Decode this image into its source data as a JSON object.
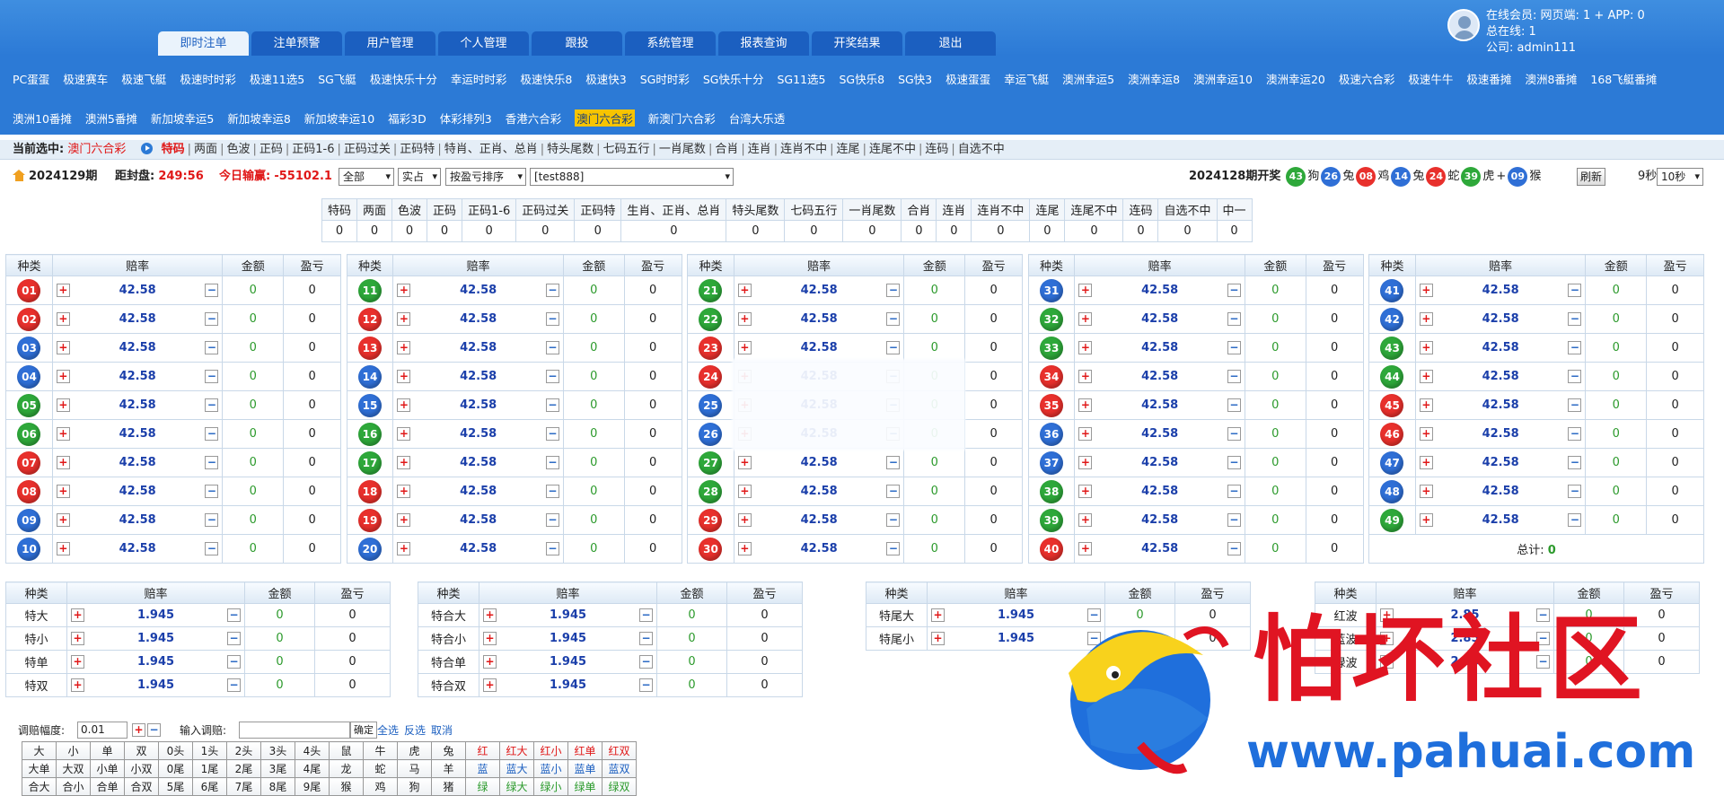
{
  "header": {
    "tabs": [
      "即时注单",
      "注单预警",
      "用户管理",
      "个人管理",
      "跟投",
      "系统管理",
      "报表查询",
      "开奖结果",
      "退出"
    ],
    "active_tab": 0,
    "user_line1": "在线会员:   网页端: 1 + APP: 0",
    "user_line2": "总在线:   1",
    "user_line3": "公司:  admin111"
  },
  "games": {
    "row1": [
      "PC蛋蛋",
      "极速赛车",
      "极速飞艇",
      "极速时时彩",
      "极速11选5",
      "SG飞艇",
      "极速快乐十分",
      "幸运时时彩",
      "极速快乐8",
      "极速快3",
      "SG时时彩",
      "SG快乐十分",
      "SG11选5",
      "SG快乐8",
      "SG快3",
      "极速蛋蛋",
      "幸运飞艇",
      "澳洲幸运5",
      "澳洲幸运8",
      "澳洲幸运10",
      "澳洲幸运20",
      "极速六合彩",
      "极速牛牛",
      "极速番摊",
      "澳洲8番摊",
      "168飞艇番摊"
    ],
    "row2": [
      "澳洲10番摊",
      "澳洲5番摊",
      "新加坡幸运5",
      "新加坡幸运8",
      "新加坡幸运10",
      "福彩3D",
      "体彩排列3",
      "香港六合彩",
      "澳门六合彩",
      "新澳门六合彩",
      "台湾大乐透"
    ],
    "selected": "澳门六合彩"
  },
  "current": {
    "label": "当前选中:",
    "game": "澳门六合彩",
    "plays": [
      "特码",
      "两面",
      "色波",
      "正码",
      "正码1-6",
      "正码过关",
      "正码特",
      "特肖、正肖、总肖",
      "特头尾数",
      "七码五行",
      "一肖尾数",
      "合肖",
      "连肖",
      "连肖不中",
      "连尾",
      "连尾不中",
      "连码",
      "自选不中"
    ],
    "selected_play": "特码"
  },
  "info": {
    "period": "2024129期",
    "close_label": "距封盘:",
    "close_time": "249:56",
    "today_label": "今日输赢:",
    "today_value": "-55102.1",
    "select_all": "全部",
    "select_mode": "实占",
    "select_sort": "按盈亏排序",
    "select_account": "[test888]",
    "draw_label": "2024128期开奖",
    "draw": [
      {
        "num": "43",
        "zodiac": "狗",
        "color": "#2ea83a"
      },
      {
        "num": "26",
        "zodiac": "兔",
        "color": "#2f6fd6"
      },
      {
        "num": "08",
        "zodiac": "鸡",
        "color": "#e8302c"
      },
      {
        "num": "14",
        "zodiac": "兔",
        "color": "#2f6fd6"
      },
      {
        "num": "24",
        "zodiac": "蛇",
        "color": "#e8302c"
      },
      {
        "num": "39",
        "zodiac": "虎",
        "color": "#2ea83a"
      },
      {
        "num": "09",
        "zodiac": "猴",
        "color": "#2f6fd6"
      }
    ],
    "plus": "+",
    "refresh": "刷新",
    "countdown": "9秒",
    "interval": "10秒"
  },
  "summary": {
    "headers": [
      "特码",
      "两面",
      "色波",
      "正码",
      "正码1-6",
      "正码过关",
      "正码特",
      "生肖、正肖、总肖",
      "特头尾数",
      "七码五行",
      "一肖尾数",
      "合肖",
      "连肖",
      "连肖不中",
      "连尾",
      "连尾不中",
      "连码",
      "自选不中",
      "中一"
    ],
    "values": [
      "0",
      "0",
      "0",
      "0",
      "0",
      "0",
      "0",
      "0",
      "0",
      "0",
      "0",
      "0",
      "0",
      "0",
      "0",
      "0",
      "0",
      "0",
      "0"
    ]
  },
  "num_headers": [
    "种类",
    "赔率",
    "金额",
    "盈亏"
  ],
  "numbers": [
    {
      "n": "01",
      "c": "red"
    },
    {
      "n": "02",
      "c": "red"
    },
    {
      "n": "03",
      "c": "blue"
    },
    {
      "n": "04",
      "c": "blue"
    },
    {
      "n": "05",
      "c": "green"
    },
    {
      "n": "06",
      "c": "green"
    },
    {
      "n": "07",
      "c": "red"
    },
    {
      "n": "08",
      "c": "red"
    },
    {
      "n": "09",
      "c": "blue"
    },
    {
      "n": "10",
      "c": "blue"
    },
    {
      "n": "11",
      "c": "green"
    },
    {
      "n": "12",
      "c": "red"
    },
    {
      "n": "13",
      "c": "red"
    },
    {
      "n": "14",
      "c": "blue"
    },
    {
      "n": "15",
      "c": "blue"
    },
    {
      "n": "16",
      "c": "green"
    },
    {
      "n": "17",
      "c": "green"
    },
    {
      "n": "18",
      "c": "red"
    },
    {
      "n": "19",
      "c": "red"
    },
    {
      "n": "20",
      "c": "blue"
    },
    {
      "n": "21",
      "c": "green"
    },
    {
      "n": "22",
      "c": "green"
    },
    {
      "n": "23",
      "c": "red"
    },
    {
      "n": "24",
      "c": "red"
    },
    {
      "n": "25",
      "c": "blue"
    },
    {
      "n": "26",
      "c": "blue"
    },
    {
      "n": "27",
      "c": "green"
    },
    {
      "n": "28",
      "c": "green"
    },
    {
      "n": "29",
      "c": "red"
    },
    {
      "n": "30",
      "c": "red"
    },
    {
      "n": "31",
      "c": "blue"
    },
    {
      "n": "32",
      "c": "green"
    },
    {
      "n": "33",
      "c": "green"
    },
    {
      "n": "34",
      "c": "red"
    },
    {
      "n": "35",
      "c": "red"
    },
    {
      "n": "36",
      "c": "blue"
    },
    {
      "n": "37",
      "c": "blue"
    },
    {
      "n": "38",
      "c": "green"
    },
    {
      "n": "39",
      "c": "green"
    },
    {
      "n": "40",
      "c": "red"
    },
    {
      "n": "41",
      "c": "blue"
    },
    {
      "n": "42",
      "c": "blue"
    },
    {
      "n": "43",
      "c": "green"
    },
    {
      "n": "44",
      "c": "green"
    },
    {
      "n": "45",
      "c": "red"
    },
    {
      "n": "46",
      "c": "red"
    },
    {
      "n": "47",
      "c": "blue"
    },
    {
      "n": "48",
      "c": "blue"
    },
    {
      "n": "49",
      "c": "green"
    }
  ],
  "num_odds": "42.58",
  "num_amount": "0",
  "num_profit": "0",
  "total_label": "总计:",
  "total_value": "0",
  "bottom": [
    {
      "rows": [
        "特大",
        "特小",
        "特单",
        "特双"
      ],
      "odds": "1.945"
    },
    {
      "rows": [
        "特合大",
        "特合小",
        "特合单",
        "特合双"
      ],
      "odds": "1.945"
    },
    {
      "rows": [
        "特尾大",
        "特尾小"
      ],
      "odds": "1.945"
    },
    {
      "rows": [
        "红波",
        "蓝波",
        "绿波"
      ],
      "odds": "2.85"
    }
  ],
  "adjust": {
    "label": "调赔幅度:",
    "step": "0.01",
    "input_label": "输入调赔:",
    "confirm": "确定",
    "select_all": "全选",
    "invert": "反选",
    "cancel": "取消"
  },
  "quick": [
    [
      "大",
      "小",
      "单",
      "双",
      "0头",
      "1头",
      "2头",
      "3头",
      "4头",
      "鼠",
      "牛",
      "虎",
      "兔",
      "红",
      "红大",
      "红小",
      "红单",
      "红双"
    ],
    [
      "大单",
      "大双",
      "小单",
      "小双",
      "0尾",
      "1尾",
      "2尾",
      "3尾",
      "4尾",
      "龙",
      "蛇",
      "马",
      "羊",
      "蓝",
      "蓝大",
      "蓝小",
      "蓝单",
      "蓝双"
    ],
    [
      "合大",
      "合小",
      "合单",
      "合双",
      "5尾",
      "6尾",
      "7尾",
      "8尾",
      "9尾",
      "猴",
      "鸡",
      "狗",
      "猪",
      "绿",
      "绿大",
      "绿小",
      "绿单",
      "绿双"
    ]
  ],
  "watermark": {
    "title": "怕坏社区",
    "url": "www.pahuai.com"
  }
}
